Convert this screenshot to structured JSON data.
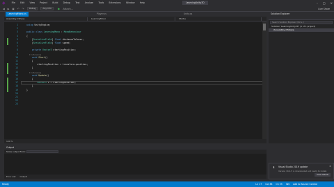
{
  "menubar": {
    "items": [
      "File",
      "Edit",
      "View",
      "Project",
      "Build",
      "Debug",
      "Test",
      "Analyze",
      "Tools",
      "Extensions",
      "Window",
      "Help"
    ],
    "title": "LearningUnity3D"
  },
  "toolbar": {
    "config": "Debug",
    "platform": "Any CPU",
    "start_label": "Attach...",
    "share_label": "Live Share"
  },
  "tabs": [
    {
      "label": "LearningMono.cs",
      "active": true
    },
    {
      "label": "Player.cs",
      "active": false
    },
    {
      "label": "Unity.cs",
      "active": false
    }
  ],
  "navbar": {
    "project": "Assembly-CSharp",
    "class": "LearningMono",
    "member": "Start()"
  },
  "code_lines": [
    {
      "n": 1,
      "html": "<span class='kw'>using</span> <span class='tx'>UnityEngine;</span>"
    },
    {
      "n": 2,
      "html": ""
    },
    {
      "n": 3,
      "html": "<span class='kw'>public class</span> <span class='ty'>LearningMono</span> <span class='tx'>:</span> <span class='ty'>MonoBehaviour</span>"
    },
    {
      "n": 4,
      "html": "<span class='tx'>{</span>"
    },
    {
      "n": 5,
      "html": "    <span class='tx'>[</span><span class='ty'>SerializeField</span><span class='tx'>]</span> <span class='kw'>float</span> <span class='tx'>distanceToCover;</span>"
    },
    {
      "n": 6,
      "html": "    <span class='tx'>[</span><span class='ty'>SerializeField</span><span class='tx'>]</span> <span class='kw'>float</span> <span class='tx'>speed;</span>"
    },
    {
      "n": 7,
      "html": ""
    },
    {
      "n": 8,
      "html": "    <span class='kw'>private</span> <span class='ty'>Vector3</span> <span class='tx'>startingPosition;</span>"
    },
    {
      "n": 9,
      "html": ""
    },
    {
      "n": 10,
      "html": "    <span class='kw'>void</span> <span class='fn'>Start</span><span class='tx'>()</span>"
    },
    {
      "n": 11,
      "html": "    <span class='tx'>{</span>"
    },
    {
      "n": 12,
      "html": "        <span class='tx'>startingPosition = transform.position;</span>"
    },
    {
      "n": 13,
      "html": "    <span class='tx'>}</span>"
    },
    {
      "n": 14,
      "html": ""
    },
    {
      "n": 15,
      "html": "    <span class='kw'>void</span> <span class='fn'>Update</span><span class='tx'>()</span>"
    },
    {
      "n": 16,
      "html": "    <span class='tx'>{</span>"
    },
    {
      "n": 17,
      "html": "        <span class='ty'>Vector3</span> <span class='tx'>v = startingPosition;</span>"
    },
    {
      "n": 18,
      "html": "    <span class='tx'>}</span>"
    },
    {
      "n": 19,
      "html": "<span class='tx'>}</span>"
    },
    {
      "n": 20,
      "html": ""
    },
    {
      "n": 21,
      "html": ""
    },
    {
      "n": 22,
      "html": ""
    },
    {
      "n": 23,
      "html": ""
    }
  ],
  "refs": {
    "start": "0 references",
    "update": "0 references"
  },
  "editor_footer": "100 %",
  "solution_explorer": {
    "title": "Solution Explorer",
    "search_placeholder": "Search Solution Explorer (Ctrl+;)",
    "items": [
      {
        "label": "Solution 'LearningUnity3D' (1 of 1 project)",
        "selected": false
      },
      {
        "label": "Assembly-CSharp",
        "selected": true
      }
    ]
  },
  "output": {
    "title": "Output",
    "show_label": "Show output from:",
    "source": "",
    "tabs": [
      "Error List",
      "Output"
    ]
  },
  "toast": {
    "title": "Visual Studio 2019 update",
    "text": "Version 16.4.5 is downloaded and ready to install.",
    "button": "View details"
  },
  "statusbar": {
    "left": "Ready",
    "right": [
      "Ln 17",
      "Col 38",
      "Ch 35",
      "INS",
      "Add to Source Control"
    ]
  },
  "colors": {
    "accent": "#007acc",
    "editor_bg": "#1e1e1e",
    "chrome_bg": "#2d2d30"
  }
}
